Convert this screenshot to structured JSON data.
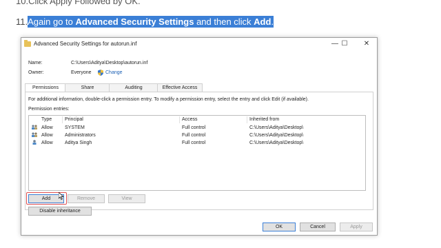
{
  "doc": {
    "prev_line": "10.Click Apply Followed by OK.",
    "step_num": "11.",
    "step_parts": [
      "Again go to ",
      "Advanced Security Settings",
      " and then click ",
      "Add",
      "."
    ]
  },
  "dialog": {
    "title": "Advanced Security Settings for autorun.inf",
    "name_label": "Name:",
    "name_value": "C:\\Users\\Aditya\\Desktop\\autorun.inf",
    "owner_label": "Owner:",
    "owner_value": "Everyone",
    "change_link": "Change",
    "tabs": [
      "Permissions",
      "Share",
      "Auditing",
      "Effective Access"
    ],
    "info_text": "For additional information, double-click a permission entry. To modify a permission entry, select the entry and click Edit (if available).",
    "entries_label": "Permission entries:",
    "columns": [
      "Type",
      "Principal",
      "Access",
      "Inherited from"
    ],
    "rows": [
      {
        "type": "Allow",
        "principal": "SYSTEM",
        "access": "Full control",
        "inherited": "C:\\Users\\Aditya\\Desktop\\"
      },
      {
        "type": "Allow",
        "principal": "Administrators",
        "access": "Full control",
        "inherited": "C:\\Users\\Aditya\\Desktop\\"
      },
      {
        "type": "Allow",
        "principal": "Aditya Singh",
        "access": "Full control",
        "inherited": "C:\\Users\\Aditya\\Desktop\\"
      }
    ],
    "buttons": {
      "add": "Add",
      "remove": "Remove",
      "view": "View",
      "disable_inheritance": "Disable inheritance",
      "ok": "OK",
      "cancel": "Cancel",
      "apply": "Apply"
    },
    "window_controls": {
      "minimize": "—",
      "maximize": "☐",
      "close": "✕"
    }
  },
  "colors": {
    "highlight": "#3b7fd6",
    "link": "#1a5fb4",
    "annotation": "#e05050"
  }
}
